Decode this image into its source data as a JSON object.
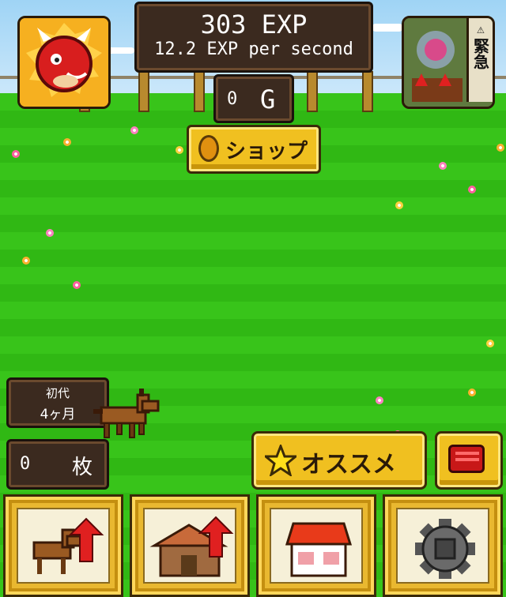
{
  "hud": {
    "exp_total": "303 EXP",
    "exp_rate": "12.2 EXP per second",
    "gold_value": "0",
    "gold_unit": "G"
  },
  "shop_button": {
    "label": "ショップ",
    "icon": "gold-coin-icon"
  },
  "emergency_banner": {
    "warning_symbol": "⚠",
    "label": "緊急",
    "icon": "warning-icon"
  },
  "dragon_app_icon": {
    "icon": "red-dragon-icon"
  },
  "generation": {
    "label": "初代",
    "age": "4ヶ月"
  },
  "tickets": {
    "count": "0",
    "unit": "枚"
  },
  "recommend_button": {
    "label": "オススメ",
    "icon": "star-icon"
  },
  "chat_button": {
    "icon": "speech-bubble-icon"
  },
  "bottom_menu": [
    {
      "name": "horse-upgrade",
      "icon": "horse-upgrade-icon"
    },
    {
      "name": "stable-upgrade",
      "icon": "stable-upgrade-icon"
    },
    {
      "name": "shop-building",
      "icon": "shop-building-icon"
    },
    {
      "name": "settings",
      "icon": "gear-icon"
    }
  ],
  "colors": {
    "grass": "#30b814",
    "panel": "#3b2a1f",
    "gold": "#f0c020",
    "accent_red": "#e02020"
  }
}
